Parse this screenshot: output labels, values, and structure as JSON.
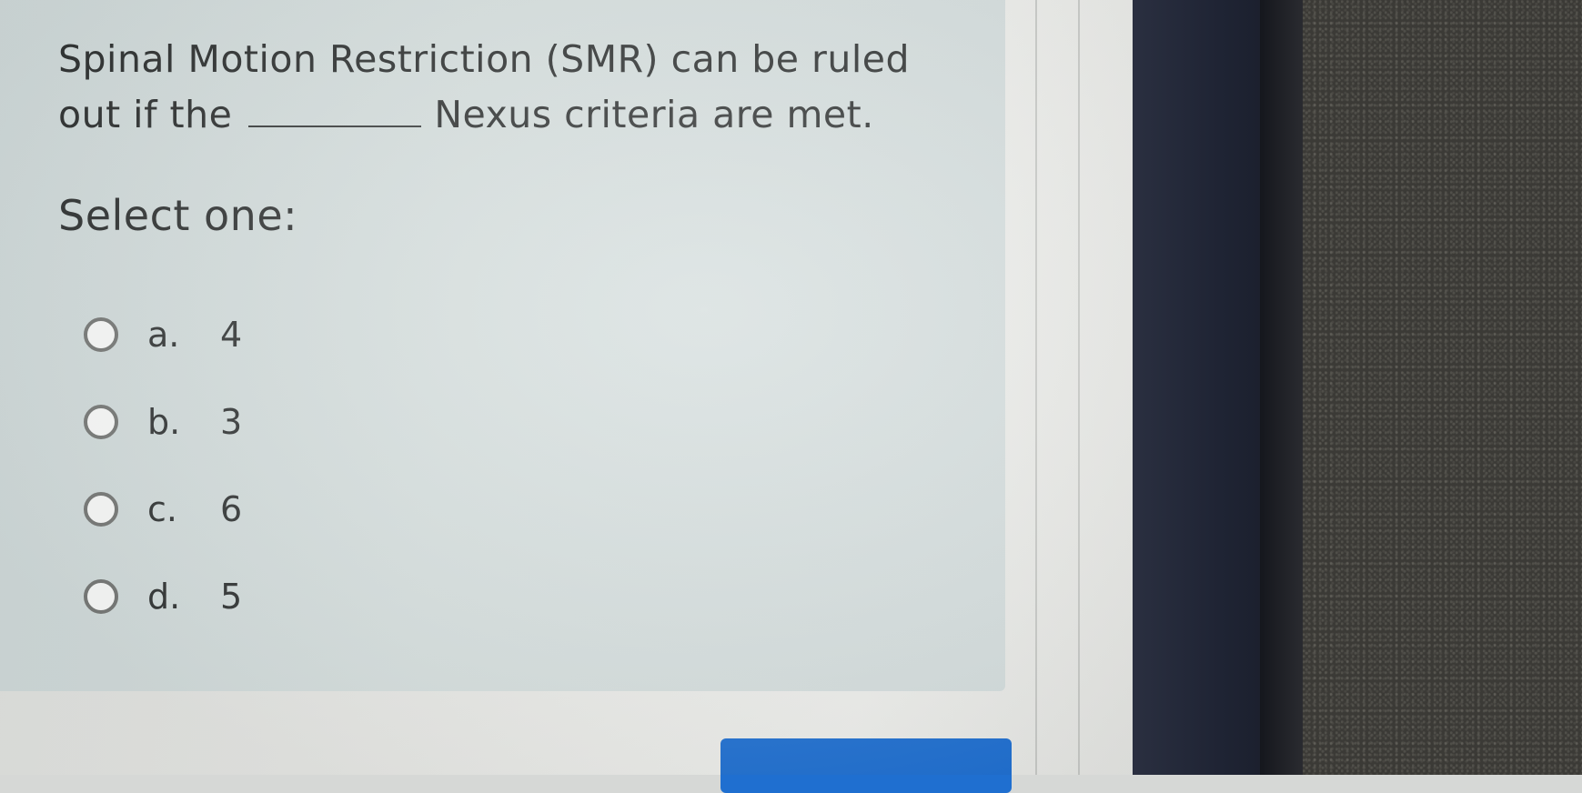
{
  "question": {
    "text_before_blank": "Spinal Motion Restriction (SMR) can be ruled out if the",
    "text_after_blank": "Nexus criteria are met."
  },
  "prompt": "Select one:",
  "options": [
    {
      "letter": "a.",
      "value": "4"
    },
    {
      "letter": "b.",
      "value": "3"
    },
    {
      "letter": "c.",
      "value": "6"
    },
    {
      "letter": "d.",
      "value": "5"
    }
  ],
  "colors": {
    "card_background": "#d3dcdc",
    "button": "#1f6fd0"
  }
}
